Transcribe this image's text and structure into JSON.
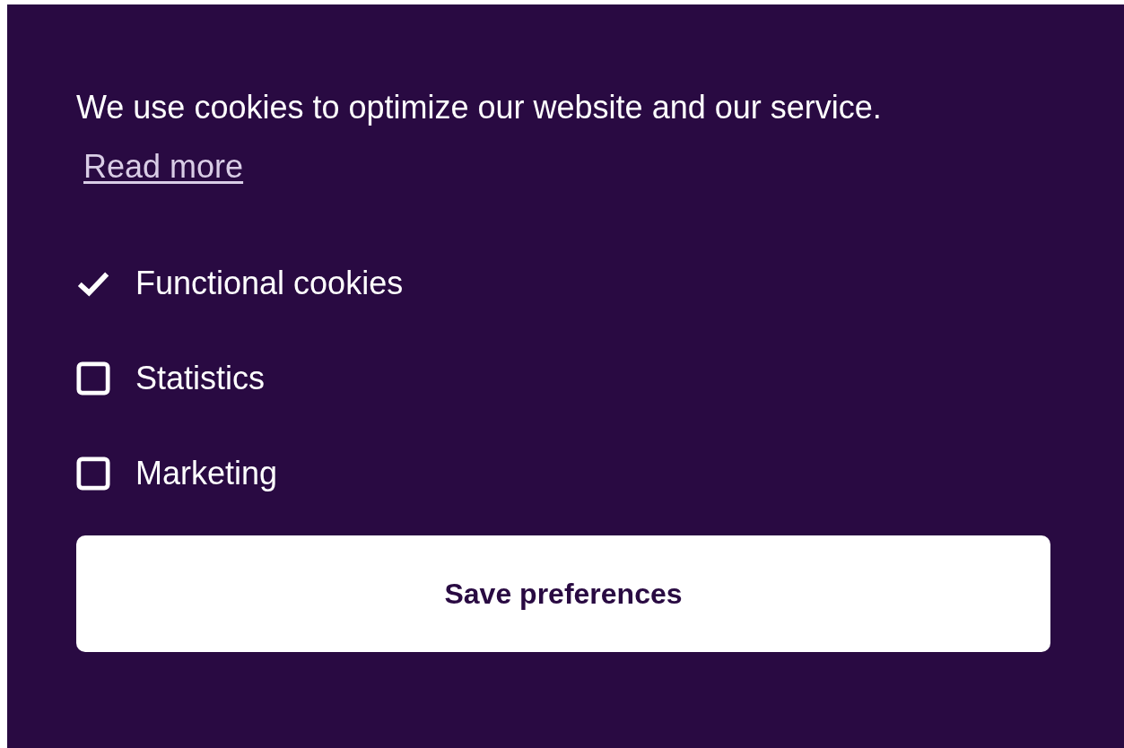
{
  "message": "We use cookies to optimize our website and our service.",
  "read_more": "Read more",
  "options": [
    {
      "label": "Functional cookies",
      "checked": true
    },
    {
      "label": "Statistics",
      "checked": false
    },
    {
      "label": "Marketing",
      "checked": false
    }
  ],
  "save_button": "Save preferences"
}
